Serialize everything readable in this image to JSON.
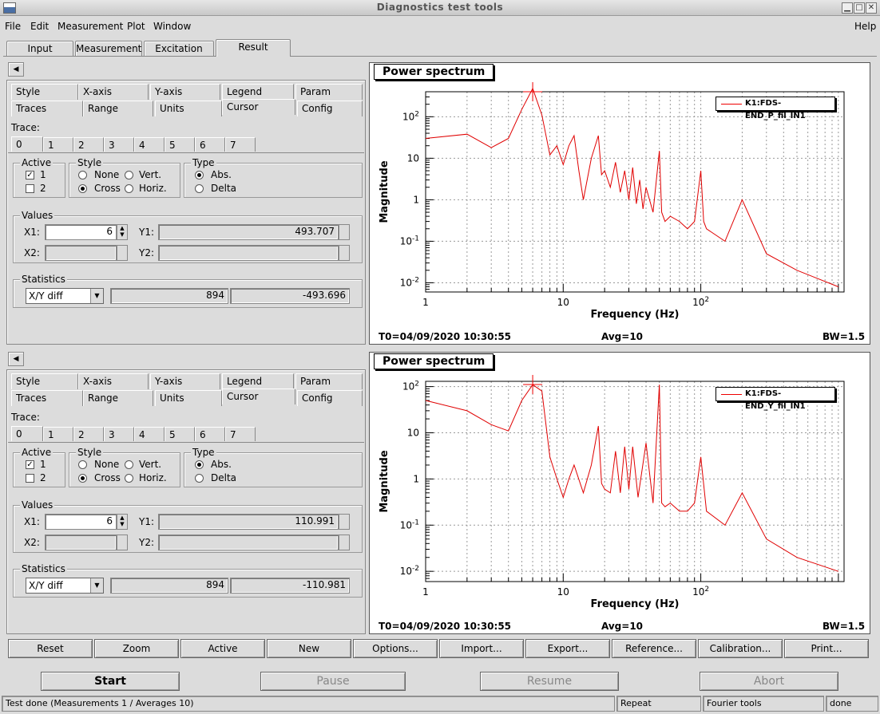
{
  "window": {
    "title": "Diagnostics test tools"
  },
  "menu": {
    "items": [
      "File",
      "Edit",
      "Measurement",
      "Plot",
      "Window"
    ],
    "help": "Help"
  },
  "main_tabs": [
    "Input",
    "Measurement",
    "Excitation",
    "Result"
  ],
  "option_tabs_row1": [
    "Style",
    "X-axis",
    "Y-axis",
    "Legend",
    "Param"
  ],
  "option_tabs_row2": [
    "Traces",
    "Range",
    "Units",
    "Cursor",
    "Config"
  ],
  "trace": {
    "label": "Trace:",
    "tabs": [
      "0",
      "1",
      "2",
      "3",
      "4",
      "5",
      "6",
      "7"
    ]
  },
  "groups": {
    "active": "Active",
    "style": "Style",
    "type": "Type",
    "values": "Values",
    "statistics": "Statistics"
  },
  "labels": {
    "active1": "1",
    "active2": "2",
    "none": "None",
    "cross": "Cross",
    "vert": "Vert.",
    "horiz": "Horiz.",
    "abs": "Abs.",
    "delta": "Delta",
    "x1": "X1:",
    "x2": "X2:",
    "y1": "Y1:",
    "y2": "Y2:"
  },
  "panels": [
    {
      "x1": "6",
      "y1": "493.707",
      "stat_mode": "X/Y diff",
      "stat_a": "894",
      "stat_b": "-493.696"
    },
    {
      "x1": "6",
      "y1": "110.991",
      "stat_mode": "X/Y diff",
      "stat_a": "894",
      "stat_b": "-110.981"
    }
  ],
  "plots": [
    {
      "title": "Power spectrum",
      "legend": "K1:FDS-END_P_fil_IN1",
      "ylabel": "Magnitude",
      "xlabel": "Frequency (Hz)",
      "t0": "T0=04/09/2020 10:30:55",
      "avg": "Avg=10",
      "bw": "BW=1.5"
    },
    {
      "title": "Power spectrum",
      "legend": "K1:FDS-END_Y_fil_IN1",
      "ylabel": "Magnitude",
      "xlabel": "Frequency (Hz)",
      "t0": "T0=04/09/2020 10:30:55",
      "avg": "Avg=10",
      "bw": "BW=1.5"
    }
  ],
  "chart_data": [
    {
      "type": "line",
      "title": "Power spectrum",
      "xlabel": "Frequency (Hz)",
      "ylabel": "Magnitude",
      "xscale": "log",
      "yscale": "log",
      "xlim": [
        1,
        1100
      ],
      "ylim": [
        0.006,
        400
      ],
      "grid": true,
      "legend_position": "top-right",
      "xticks": [
        "1",
        "10",
        "10^2"
      ],
      "yticks": [
        "10^-2",
        "10^-1",
        "1",
        "10",
        "10^2"
      ],
      "series": [
        {
          "name": "K1:FDS-END_P_fil_IN1",
          "color": "#e00000",
          "x": [
            1,
            2,
            3,
            4,
            5,
            6,
            7,
            8,
            9,
            10,
            11,
            12,
            13,
            14,
            16,
            18,
            19,
            20,
            22,
            24,
            26,
            28,
            30,
            32,
            34,
            36,
            38,
            40,
            45,
            50,
            52,
            55,
            60,
            70,
            80,
            90,
            100,
            105,
            110,
            150,
            200,
            300,
            500,
            1000
          ],
          "y": [
            30,
            38,
            18,
            30,
            150,
            480,
            110,
            12,
            20,
            7,
            20,
            35,
            5,
            1,
            10,
            35,
            4,
            5,
            2,
            8,
            1.5,
            5,
            1,
            6,
            0.8,
            3,
            0.6,
            2,
            0.5,
            15,
            0.5,
            0.3,
            0.4,
            0.3,
            0.2,
            0.3,
            5,
            0.3,
            0.2,
            0.1,
            1,
            0.05,
            0.02,
            0.008
          ]
        }
      ],
      "cursor": {
        "x": 6,
        "y": 493.707
      }
    },
    {
      "type": "line",
      "title": "Power spectrum",
      "xlabel": "Frequency (Hz)",
      "ylabel": "Magnitude",
      "xscale": "log",
      "yscale": "log",
      "xlim": [
        1,
        1100
      ],
      "ylim": [
        0.006,
        130
      ],
      "grid": true,
      "legend_position": "top-right",
      "xticks": [
        "1",
        "10",
        "10^2"
      ],
      "yticks": [
        "10^-2",
        "10^-1",
        "1",
        "10",
        "10^2"
      ],
      "series": [
        {
          "name": "K1:FDS-END_Y_fil_IN1",
          "color": "#e00000",
          "x": [
            1,
            2,
            3,
            4,
            5,
            6,
            7,
            8,
            9,
            10,
            11,
            12,
            14,
            16,
            18,
            19,
            20,
            22,
            24,
            26,
            28,
            30,
            32,
            35,
            40,
            45,
            50,
            52,
            55,
            60,
            70,
            80,
            90,
            100,
            110,
            150,
            200,
            300,
            500,
            1000
          ],
          "y": [
            50,
            30,
            15,
            11,
            50,
            110,
            80,
            3,
            1,
            0.4,
            1,
            2,
            0.5,
            2,
            14,
            0.8,
            0.6,
            0.5,
            4,
            0.5,
            5,
            0.6,
            5,
            0.4,
            6,
            0.3,
            110,
            0.3,
            0.25,
            0.3,
            0.2,
            0.2,
            0.3,
            3,
            0.2,
            0.1,
            0.5,
            0.05,
            0.02,
            0.01
          ]
        }
      ],
      "cursor": {
        "x": 6,
        "y": 110.991
      }
    }
  ],
  "buttons": [
    "Reset",
    "Zoom",
    "Active",
    "New",
    "Options...",
    "Import...",
    "Export...",
    "Reference...",
    "Calibration...",
    "Print..."
  ],
  "controls": {
    "start": "Start",
    "pause": "Pause",
    "resume": "Resume",
    "abort": "Abort"
  },
  "status": {
    "main": "Test done (Measurements 1 / Averages 10)",
    "mode": "Repeat",
    "tool": "Fourier tools",
    "state": "done"
  }
}
